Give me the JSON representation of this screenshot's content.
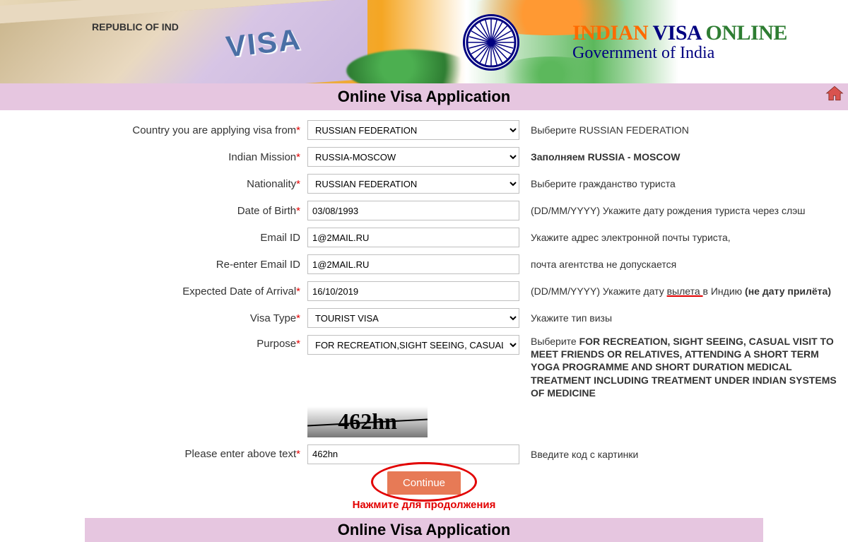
{
  "header": {
    "visa_doc_text": "REPUBLIC OF IND",
    "site_title_1": "INDIAN",
    "site_title_2": "VISA",
    "site_title_3": "ONLINE",
    "site_subtitle": "Government of India"
  },
  "title_bar": "Online Visa Application",
  "form": {
    "rows": {
      "country": {
        "label": "Country you are applying visa from",
        "value": "RUSSIAN FEDERATION",
        "hint": "Выберите RUSSIAN FEDERATION"
      },
      "mission": {
        "label": "Indian Mission",
        "value": "RUSSIA-MOSCOW",
        "hint": "Заполняем RUSSIA - MOSCOW"
      },
      "nationality": {
        "label": "Nationality",
        "value": "RUSSIAN FEDERATION",
        "hint": "Выберите гражданство туриста"
      },
      "dob": {
        "label": "Date of Birth",
        "value": "03/08/1993",
        "hint": "(DD/MM/YYYY) Укажите дату рождения туриста через слэш"
      },
      "email": {
        "label": "Email ID",
        "value": "1@2MAIL.RU",
        "hint_line1": "Укажите адрес электронной почты туриста,",
        "hint_line2": "почта агентства не допускается"
      },
      "email2": {
        "label": "Re-enter Email ID",
        "value": "1@2MAIL.RU"
      },
      "arrival": {
        "label": "Expected Date of Arrival",
        "value": "16/10/2019",
        "hint_prefix": "(DD/MM/YYYY) Укажите дату ",
        "hint_underlined": "вылета ",
        "hint_mid": "в Индию  ",
        "hint_bold": "(не дату прилёта)"
      },
      "visa_type": {
        "label": "Visa Type",
        "value": "TOURIST VISA",
        "hint": "Укажите тип визы"
      },
      "purpose": {
        "label": "Purpose",
        "value": "FOR RECREATION,SIGHT SEEING, CASUAL VIS",
        "hint_prefix": "Выберите ",
        "hint_bold": "FOR RECREATION, SIGHT SEEING, CASUAL VISIT TO MEET FRIENDS OR RELATIVES, ATTENDING A SHORT TERM YOGA PROGRAMME AND SHORT DURATION MEDICAL TREATMENT INCLUDING TREATMENT UNDER INDIAN SYSTEMS OF MEDICINE"
      },
      "captcha": {
        "image_text": "462hn"
      },
      "captcha_input": {
        "label": "Please enter above text",
        "value": "462hn",
        "hint": "Введите код с картинки"
      }
    },
    "continue_label": "Continue",
    "press_note": "Нажмите для продолжения"
  },
  "footer_bar": "Online Visa Application"
}
